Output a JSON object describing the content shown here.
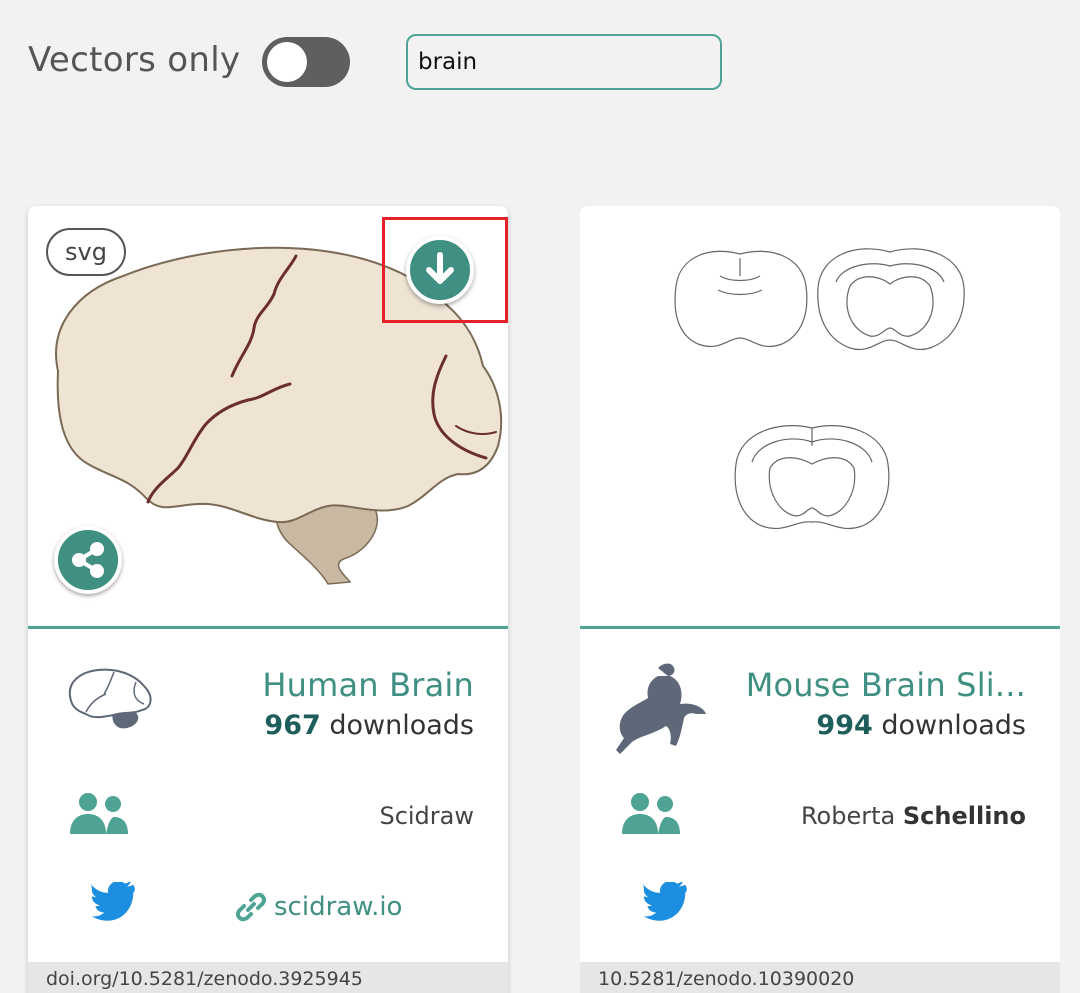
{
  "filter": {
    "vectors_only_label": "Vectors only",
    "vectors_only_enabled": false,
    "search_value": "brain"
  },
  "colors": {
    "accent": "#4fa395",
    "button": "#3f8f82",
    "highlight": "#e8202a",
    "twitter": "#1d8fe0",
    "icon_gray": "#5f6878"
  },
  "cards": [
    {
      "badge": "svg",
      "title": "Human Brain",
      "downloads_count": "967",
      "downloads_label": "downloads",
      "author_first": "Scidraw",
      "author_last": "",
      "site_link": "scidraw.io",
      "doi": "doi.org/10.5281/zenodo.3925945",
      "icons": [
        "download-icon",
        "share-icon",
        "users-icon",
        "twitter-icon",
        "link-icon"
      ]
    },
    {
      "title": "Mouse Brain Sli...",
      "downloads_count": "994",
      "downloads_label": "downloads",
      "author_first": "Roberta",
      "author_last": "Schellino",
      "doi": "10.5281/zenodo.10390020",
      "icons": [
        "users-icon",
        "twitter-icon"
      ]
    }
  ]
}
